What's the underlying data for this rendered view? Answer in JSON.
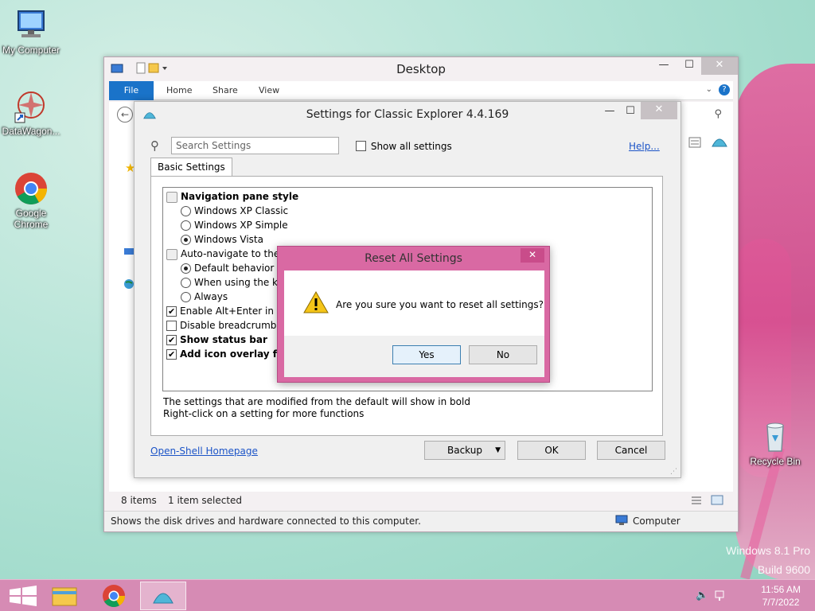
{
  "desktop": {
    "icons": [
      {
        "label": "My Computer"
      },
      {
        "label": "DataWagon..."
      },
      {
        "label": "Google Chrome"
      },
      {
        "label": "Recycle Bin"
      }
    ],
    "watermark_line1": "Windows 8.1 Pro",
    "watermark_line2": "Build 9600"
  },
  "explorer": {
    "title": "Desktop",
    "ribbon_tabs": [
      "File",
      "Home",
      "Share",
      "View"
    ],
    "status_items": "8 items",
    "status_selected": "1 item selected",
    "bottom_status": "Shows the disk drives and hardware connected to this computer.",
    "bottom_location": "Computer"
  },
  "settings": {
    "title": "Settings for Classic Explorer 4.4.169",
    "search_placeholder": "Search Settings",
    "show_all_label": "Show all settings",
    "show_all_checked": false,
    "help_link": "Help...",
    "tab_label": "Basic Settings",
    "tree": [
      {
        "kind": "group",
        "label": "Navigation pane style",
        "bold": true
      },
      {
        "kind": "radio",
        "label": "Windows XP Classic",
        "checked": false
      },
      {
        "kind": "radio",
        "label": "Windows XP Simple",
        "checked": false
      },
      {
        "kind": "radio",
        "label": "Windows Vista",
        "checked": true
      },
      {
        "kind": "group",
        "label": "Auto-navigate to the s",
        "bold": false
      },
      {
        "kind": "radio",
        "label": "Default behavior",
        "checked": true
      },
      {
        "kind": "radio",
        "label": "When using the ke",
        "checked": false
      },
      {
        "kind": "radio",
        "label": "Always",
        "checked": false
      },
      {
        "kind": "check",
        "label": "Enable Alt+Enter in the",
        "checked": true,
        "bold": false
      },
      {
        "kind": "check",
        "label": "Disable breadcrumbs",
        "checked": false,
        "bold": false
      },
      {
        "kind": "check",
        "label": "Show status bar",
        "checked": true,
        "bold": true
      },
      {
        "kind": "check",
        "label": "Add icon overlay for s",
        "checked": true,
        "bold": true
      }
    ],
    "note1": "The settings that are modified from the default will show in bold",
    "note2": "Right-click on a setting for more functions",
    "homepage_link": "Open-Shell Homepage",
    "backup_button": "Backup",
    "ok_button": "OK",
    "cancel_button": "Cancel"
  },
  "reset_dialog": {
    "title": "Reset All Settings",
    "message": "Are you sure you want to reset all settings?",
    "yes_button": "Yes",
    "no_button": "No"
  },
  "taskbar": {
    "time": "11:56 AM",
    "date": "7/7/2022"
  }
}
